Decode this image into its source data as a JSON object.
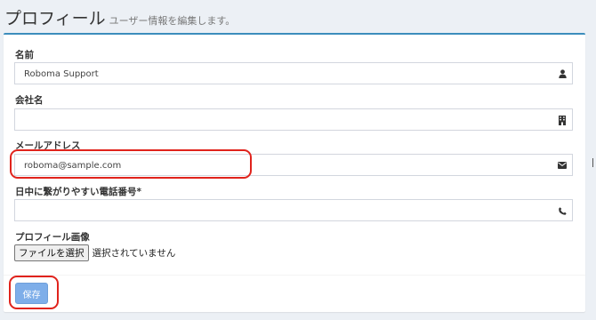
{
  "header": {
    "title": "プロフィール",
    "subtitle": "ユーザー情報を編集します。"
  },
  "form": {
    "name_label": "名前",
    "name_value": "Roboma Support",
    "company_label": "会社名",
    "company_value": "",
    "email_label": "メールアドレス",
    "email_value": "roboma@sample.com",
    "phone_label": "日中に繋がりやすい電話番号*",
    "phone_value": "",
    "image_label": "プロフィール画像",
    "file_button_label": "ファイルを選択",
    "file_status": "選択されていません",
    "save_label": "保存"
  },
  "icons": {
    "name": "user-icon",
    "company": "building-icon",
    "email": "envelope-icon",
    "phone": "phone-icon"
  },
  "colors": {
    "accent": "#3c8dbc",
    "save_button": "#7eaee9",
    "highlight": "#e0231c"
  }
}
